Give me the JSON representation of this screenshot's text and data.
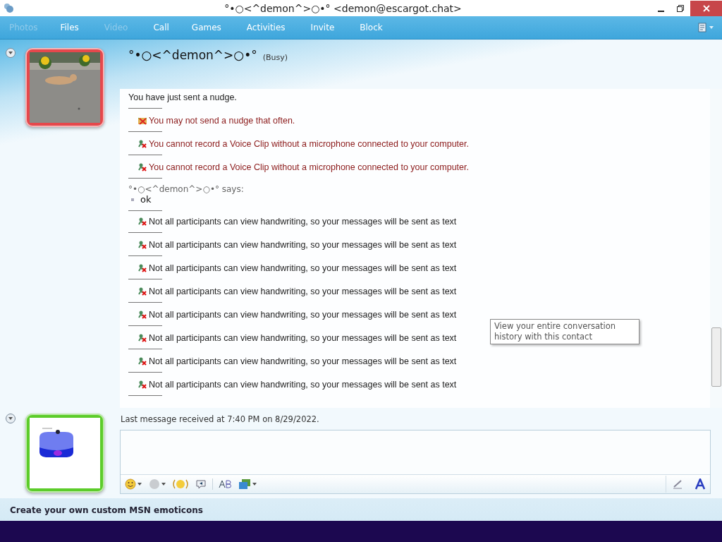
{
  "window": {
    "title": "°•○<^demon^>○•° <demon@escargot.chat>"
  },
  "menu": [
    {
      "label": "Photos",
      "disabled": true
    },
    {
      "label": "Files",
      "disabled": false
    },
    {
      "label": "Video",
      "disabled": true
    },
    {
      "label": "Call",
      "disabled": false
    },
    {
      "label": "Games",
      "disabled": false
    },
    {
      "label": "Activities",
      "disabled": false
    },
    {
      "label": "Invite",
      "disabled": false
    },
    {
      "label": "Block",
      "disabled": false
    }
  ],
  "contact": {
    "name": "°•○<^demon^>○•°",
    "status": "(Busy)"
  },
  "avatars": [
    {
      "color": "#e5484c"
    },
    {
      "color": "#5ccc2a"
    }
  ],
  "messages": [
    {
      "kind": "plain",
      "text": "You have just sent a nudge."
    },
    {
      "kind": "nudge",
      "text": "You may not send a nudge that often."
    },
    {
      "kind": "voice_error",
      "text": "You cannot record a Voice Clip without a microphone connected to your computer."
    },
    {
      "kind": "voice_error",
      "text": "You cannot record a Voice Clip without a microphone connected to your computer."
    },
    {
      "kind": "chat",
      "sender": "°•○<^demon^>○•° says:",
      "text": "ok"
    },
    {
      "kind": "mic",
      "text": "Not all participants can view handwriting, so your messages will be sent as text"
    },
    {
      "kind": "mic",
      "text": "Not all participants can view handwriting, so your messages will be sent as text"
    },
    {
      "kind": "mic",
      "text": "Not all participants can view handwriting, so your messages will be sent as text"
    },
    {
      "kind": "mic",
      "text": "Not all participants can view handwriting, so your messages will be sent as text"
    },
    {
      "kind": "mic",
      "text": "Not all participants can view handwriting, so your messages will be sent as text"
    },
    {
      "kind": "mic",
      "text": "Not all participants can view handwriting, so your messages will be sent as text"
    },
    {
      "kind": "mic",
      "text": "Not all participants can view handwriting, so your messages will be sent as text"
    },
    {
      "kind": "mic",
      "text": "Not all participants can view handwriting, so your messages will be sent as text"
    }
  ],
  "tooltip": "View your entire conversation history with this contact",
  "last_message": "Last message received at 7:40 PM on 8/29/2022.",
  "footer_link": "Create your own custom MSN emoticons"
}
